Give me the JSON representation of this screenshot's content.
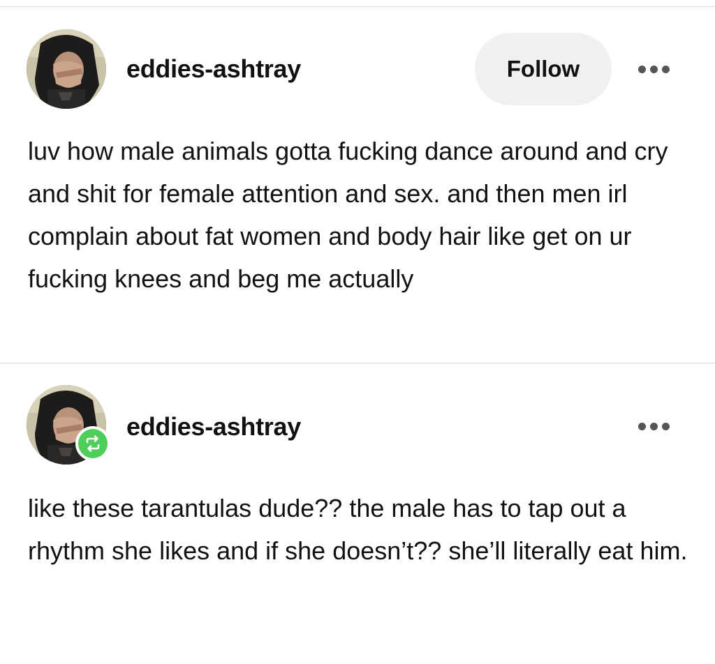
{
  "posts": [
    {
      "username": "eddies-ashtray",
      "follow_label": "Follow",
      "more_label": "More options",
      "body": "luv how male animals gotta fucking dance around and cry and shit for female attention and sex. and then men irl complain about fat women and body hair like get on ur fucking knees and beg me actually",
      "avatar": "profile-photo"
    },
    {
      "username": "eddies-ashtray",
      "more_label": "More options",
      "badge_icon": "reblog-icon",
      "badge_color": "#4fcd5a",
      "body": "like these tarantulas dude?? the male has to tap out a rhythm she likes and if she doesn’t?? she’ll literally eat him.",
      "avatar": "profile-photo"
    }
  ],
  "colors": {
    "follow_bg": "#f0f0f0",
    "divider": "#d6d6d6",
    "text": "#111111",
    "dots": "#555555"
  }
}
